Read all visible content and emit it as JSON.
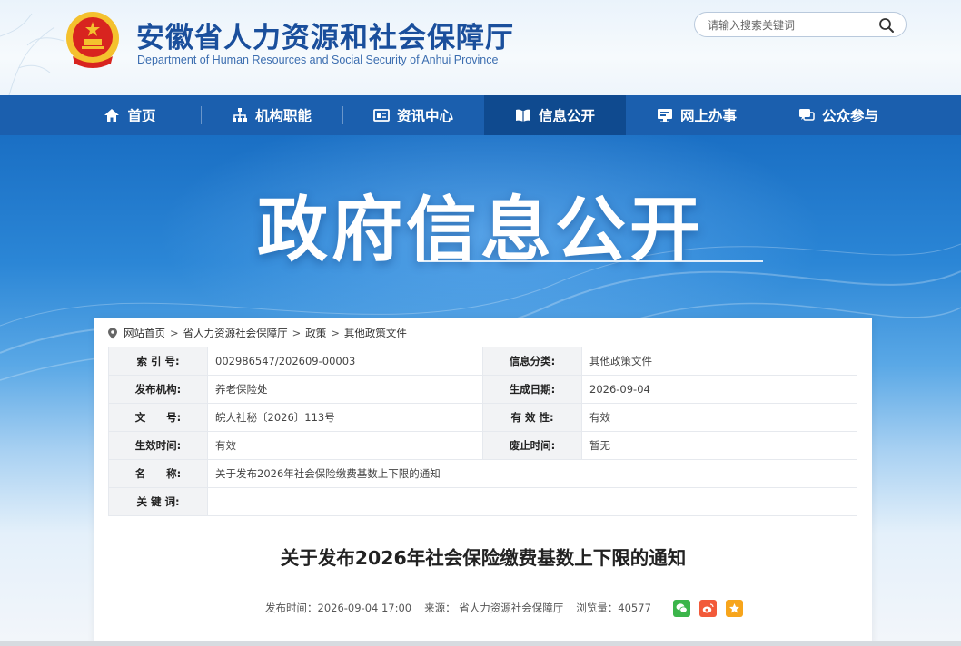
{
  "header": {
    "title": "安徽省人力资源和社会保障厅",
    "subtitle": "Department of Human Resources and Social Security of Anhui Province",
    "search_placeholder": "请输入搜索关键词"
  },
  "nav": {
    "items": [
      {
        "label": "首页",
        "icon": "home-icon"
      },
      {
        "label": "机构职能",
        "icon": "org-chart-icon"
      },
      {
        "label": "资讯中心",
        "icon": "news-icon"
      },
      {
        "label": "信息公开",
        "icon": "open-book-icon",
        "active": true
      },
      {
        "label": "网上办事",
        "icon": "monitor-icon"
      },
      {
        "label": "公众参与",
        "icon": "chat-icon"
      }
    ]
  },
  "banner": {
    "title": "政府信息公开"
  },
  "breadcrumb": [
    "网站首页",
    "省人力资源社会保障厅",
    "政策",
    "其他政策文件"
  ],
  "meta": {
    "index_label": "索 引 号:",
    "index_value": "002986547/202609-00003",
    "category_label": "信息分类:",
    "category_value": "其他政策文件",
    "org_label": "发布机构:",
    "org_value": "养老保险处",
    "date_label": "生成日期:",
    "date_value": "2026-09-04",
    "docno_label": "文　　号:",
    "docno_value": "皖人社秘〔2026〕113号",
    "validity_label": "有 效 性:",
    "validity_value": "有效",
    "effective_label": "生效时间:",
    "effective_value": "有效",
    "expire_label": "废止时间:",
    "expire_value": "暂无",
    "name_label": "名　　称:",
    "name_value": "关于发布2026年社会保险缴费基数上下限的通知",
    "keywords_label": "关 键 词:",
    "keywords_value": ""
  },
  "article": {
    "title": "关于发布2026年社会保险缴费基数上下限的通知",
    "publish_time": "发布时间：2026-09-04 17:00",
    "source": "来源：  省人力资源社会保障厅",
    "views": "浏览量：40577"
  },
  "colors": {
    "nav_bg": "#1b5fae",
    "nav_active": "#0f4a8f",
    "title_blue": "#1a4f9c",
    "wechat": "#3bb54a",
    "weibo": "#f25a3a",
    "favorite": "#f7a51c"
  }
}
